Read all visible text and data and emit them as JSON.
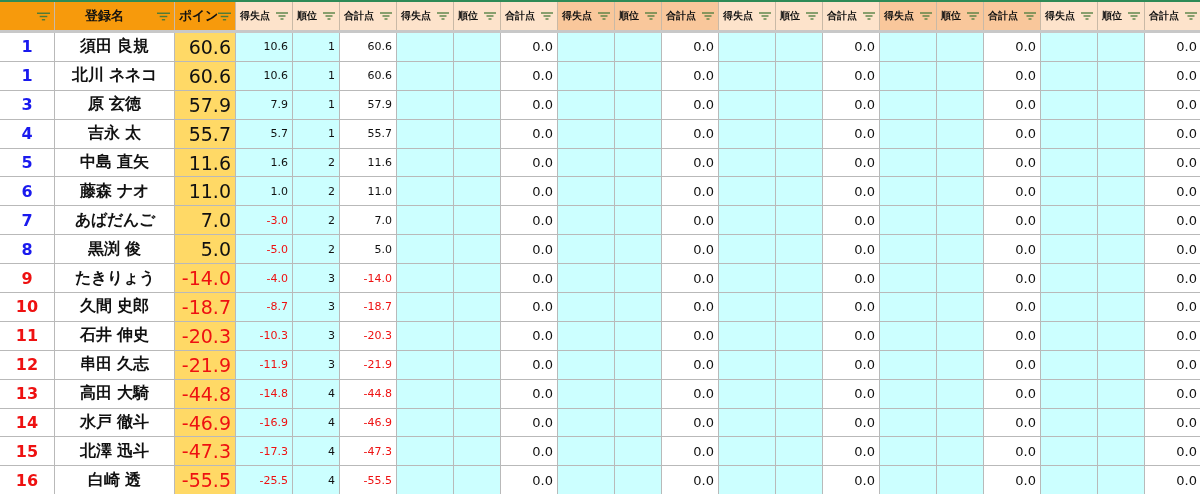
{
  "header": {
    "main_columns": [
      {},
      {
        "label": "登録名"
      },
      {
        "label": "ポイン"
      }
    ],
    "groups": [
      {
        "shaded": false,
        "labels": [
          "得失点",
          "順位",
          "合計点"
        ]
      },
      {
        "shaded": false,
        "labels": [
          "得失点",
          "順位",
          "合計点"
        ]
      },
      {
        "shaded": true,
        "labels": [
          "得失点",
          "順位",
          "合計点"
        ]
      },
      {
        "shaded": false,
        "labels": [
          "得失点",
          "順位",
          "合計点"
        ]
      },
      {
        "shaded": true,
        "labels": [
          "得失点",
          "順位",
          "合計点"
        ]
      },
      {
        "shaded": false,
        "labels": [
          "得失点",
          "順位",
          "合計点"
        ]
      }
    ]
  },
  "rows": [
    {
      "rank": "1",
      "name": "須田 良規",
      "points": "60.6",
      "negative": false,
      "diff": "10.6",
      "diff_negative": false,
      "round_rank": "1",
      "total": "60.6",
      "other_totals": [
        "0.0",
        "0.0",
        "0.0",
        "0.0",
        "0.0"
      ]
    },
    {
      "rank": "1",
      "name": "北川 ネネコ",
      "points": "60.6",
      "negative": false,
      "diff": "10.6",
      "diff_negative": false,
      "round_rank": "1",
      "total": "60.6",
      "other_totals": [
        "0.0",
        "0.0",
        "0.0",
        "0.0",
        "0.0"
      ]
    },
    {
      "rank": "3",
      "name": "原 玄徳",
      "points": "57.9",
      "negative": false,
      "diff": "7.9",
      "diff_negative": false,
      "round_rank": "1",
      "total": "57.9",
      "other_totals": [
        "0.0",
        "0.0",
        "0.0",
        "0.0",
        "0.0"
      ]
    },
    {
      "rank": "4",
      "name": "吉永 太",
      "points": "55.7",
      "negative": false,
      "diff": "5.7",
      "diff_negative": false,
      "round_rank": "1",
      "total": "55.7",
      "other_totals": [
        "0.0",
        "0.0",
        "0.0",
        "0.0",
        "0.0"
      ]
    },
    {
      "rank": "5",
      "name": "中島 直矢",
      "points": "11.6",
      "negative": false,
      "diff": "1.6",
      "diff_negative": false,
      "round_rank": "2",
      "total": "11.6",
      "other_totals": [
        "0.0",
        "0.0",
        "0.0",
        "0.0",
        "0.0"
      ]
    },
    {
      "rank": "6",
      "name": "藤森 ナオ",
      "points": "11.0",
      "negative": false,
      "diff": "1.0",
      "diff_negative": false,
      "round_rank": "2",
      "total": "11.0",
      "other_totals": [
        "0.0",
        "0.0",
        "0.0",
        "0.0",
        "0.0"
      ]
    },
    {
      "rank": "7",
      "name": "あばだんご",
      "points": "7.0",
      "negative": false,
      "diff": "-3.0",
      "diff_negative": true,
      "round_rank": "2",
      "total": "7.0",
      "other_totals": [
        "0.0",
        "0.0",
        "0.0",
        "0.0",
        "0.0"
      ]
    },
    {
      "rank": "8",
      "name": "黒渕 俊",
      "points": "5.0",
      "negative": false,
      "diff": "-5.0",
      "diff_negative": true,
      "round_rank": "2",
      "total": "5.0",
      "other_totals": [
        "0.0",
        "0.0",
        "0.0",
        "0.0",
        "0.0"
      ]
    },
    {
      "rank": "9",
      "name": "たきりょう",
      "points": "-14.0",
      "negative": true,
      "diff": "-4.0",
      "diff_negative": true,
      "round_rank": "3",
      "total": "-14.0",
      "other_totals": [
        "0.0",
        "0.0",
        "0.0",
        "0.0",
        "0.0"
      ]
    },
    {
      "rank": "10",
      "name": "久間 史郎",
      "points": "-18.7",
      "negative": true,
      "diff": "-8.7",
      "diff_negative": true,
      "round_rank": "3",
      "total": "-18.7",
      "other_totals": [
        "0.0",
        "0.0",
        "0.0",
        "0.0",
        "0.0"
      ]
    },
    {
      "rank": "11",
      "name": "石井 伸史",
      "points": "-20.3",
      "negative": true,
      "diff": "-10.3",
      "diff_negative": true,
      "round_rank": "3",
      "total": "-20.3",
      "other_totals": [
        "0.0",
        "0.0",
        "0.0",
        "0.0",
        "0.0"
      ]
    },
    {
      "rank": "12",
      "name": "串田 久志",
      "points": "-21.9",
      "negative": true,
      "diff": "-11.9",
      "diff_negative": true,
      "round_rank": "3",
      "total": "-21.9",
      "other_totals": [
        "0.0",
        "0.0",
        "0.0",
        "0.0",
        "0.0"
      ]
    },
    {
      "rank": "13",
      "name": "高田 大騎",
      "points": "-44.8",
      "negative": true,
      "diff": "-14.8",
      "diff_negative": true,
      "round_rank": "4",
      "total": "-44.8",
      "other_totals": [
        "0.0",
        "0.0",
        "0.0",
        "0.0",
        "0.0"
      ]
    },
    {
      "rank": "14",
      "name": "水戸 徹斗",
      "points": "-46.9",
      "negative": true,
      "diff": "-16.9",
      "diff_negative": true,
      "round_rank": "4",
      "total": "-46.9",
      "other_totals": [
        "0.0",
        "0.0",
        "0.0",
        "0.0",
        "0.0"
      ]
    },
    {
      "rank": "15",
      "name": "北澤 迅斗",
      "points": "-47.3",
      "negative": true,
      "diff": "-17.3",
      "diff_negative": true,
      "round_rank": "4",
      "total": "-47.3",
      "other_totals": [
        "0.0",
        "0.0",
        "0.0",
        "0.0",
        "0.0"
      ]
    },
    {
      "rank": "16",
      "name": "白崎 透",
      "points": "-55.5",
      "negative": true,
      "diff": "-25.5",
      "diff_negative": true,
      "round_rank": "4",
      "total": "-55.5",
      "other_totals": [
        "0.0",
        "0.0",
        "0.0",
        "0.0",
        "0.0"
      ]
    }
  ]
}
